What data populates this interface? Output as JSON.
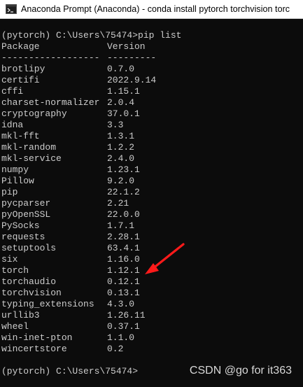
{
  "window": {
    "title": "Anaconda Prompt (Anaconda) - conda  install pytorch torchvision torc",
    "icon": "terminal-icon"
  },
  "console": {
    "prompt_command": "(pytorch) C:\\Users\\75474>pip list",
    "header_package": "Package",
    "header_version": "Version",
    "separator_package": "------------------",
    "separator_version": "---------",
    "packages": [
      {
        "name": "brotlipy",
        "version": "0.7.0"
      },
      {
        "name": "certifi",
        "version": "2022.9.14"
      },
      {
        "name": "cffi",
        "version": "1.15.1"
      },
      {
        "name": "charset-normalizer",
        "version": "2.0.4"
      },
      {
        "name": "cryptography",
        "version": "37.0.1"
      },
      {
        "name": "idna",
        "version": "3.3"
      },
      {
        "name": "mkl-fft",
        "version": "1.3.1"
      },
      {
        "name": "mkl-random",
        "version": "1.2.2"
      },
      {
        "name": "mkl-service",
        "version": "2.4.0"
      },
      {
        "name": "numpy",
        "version": "1.23.1"
      },
      {
        "name": "Pillow",
        "version": "9.2.0"
      },
      {
        "name": "pip",
        "version": "22.1.2"
      },
      {
        "name": "pycparser",
        "version": "2.21"
      },
      {
        "name": "pyOpenSSL",
        "version": "22.0.0"
      },
      {
        "name": "PySocks",
        "version": "1.7.1"
      },
      {
        "name": "requests",
        "version": "2.28.1"
      },
      {
        "name": "setuptools",
        "version": "63.4.1"
      },
      {
        "name": "six",
        "version": "1.16.0"
      },
      {
        "name": "torch",
        "version": "1.12.1"
      },
      {
        "name": "torchaudio",
        "version": "0.12.1"
      },
      {
        "name": "torchvision",
        "version": "0.13.1"
      },
      {
        "name": "typing_extensions",
        "version": "4.3.0"
      },
      {
        "name": "urllib3",
        "version": "1.26.11"
      },
      {
        "name": "wheel",
        "version": "0.37.1"
      },
      {
        "name": "win-inet-pton",
        "version": "1.1.0"
      },
      {
        "name": "wincertstore",
        "version": "0.2"
      }
    ],
    "final_prompt": "(pytorch) C:\\Users\\75474>"
  },
  "annotation": {
    "arrow_color": "#ff1a1a",
    "points_to": "torch"
  },
  "watermark": "CSDN @go for it363",
  "colors": {
    "terminal_bg": "#0c0c0c",
    "terminal_text": "#cccccc",
    "titlebar_bg": "#ffffff"
  }
}
